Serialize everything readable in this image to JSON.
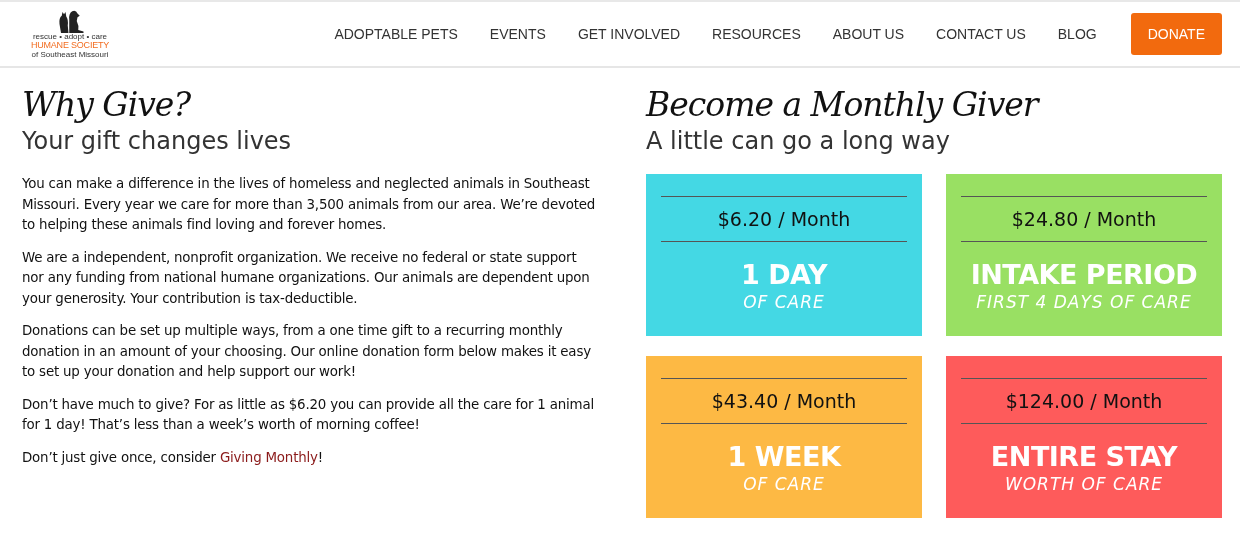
{
  "logo": {
    "tagline": "rescue • adopt • care",
    "name": "HUMANE SOCIETY",
    "subtitle": "of Southeast Missouri"
  },
  "nav": [
    "ADOPTABLE PETS",
    "EVENTS",
    "GET INVOLVED",
    "RESOURCES",
    "ABOUT US",
    "CONTACT US",
    "BLOG"
  ],
  "donate_button": "DONATE",
  "why_give": {
    "title": "Why Give?",
    "subtitle": "Your gift changes lives",
    "paragraphs": [
      "You can make a difference in the lives of homeless and neglected animals in Southeast Missouri. Every year we care for more than 3,500 animals from our area. We’re devoted to helping these animals find loving and forever homes.",
      "We are a independent, nonprofit organization. We receive no federal or state support nor any funding from national humane organizations. Our animals are dependent upon your generosity. Your contribution is tax-deductible.",
      "Donations can be set up multiple ways, from a one time gift to a recurring monthly donation in an amount of your choosing. Our online donation form below makes it easy to set up your donation and help support our work!",
      "Don’t have much to give? For as little as $6.20 you can provide all the care for 1 animal for 1 day! That’s less than a week’s worth of morning coffee!"
    ],
    "closing": {
      "before": "Don’t just give once, consider ",
      "link": "Giving Monthly",
      "after": "!"
    }
  },
  "monthly": {
    "title": "Become a Monthly Giver",
    "subtitle": "A little can go a long way",
    "cards": [
      {
        "price": "$6.20 / Month",
        "headline": "1 DAY",
        "detail": "OF CARE",
        "color": "#44d8e4"
      },
      {
        "price": "$24.80 / Month",
        "headline": "INTAKE PERIOD",
        "detail": "FIRST 4 DAYS OF CARE",
        "color": "#99e063"
      },
      {
        "price": "$43.40 / Month",
        "headline": "1 WEEK",
        "detail": "OF CARE",
        "color": "#fdb944"
      },
      {
        "price": "$124.00 / Month",
        "headline": "ENTIRE STAY",
        "detail": "WORTH OF CARE",
        "color": "#fe5b5b"
      }
    ]
  }
}
